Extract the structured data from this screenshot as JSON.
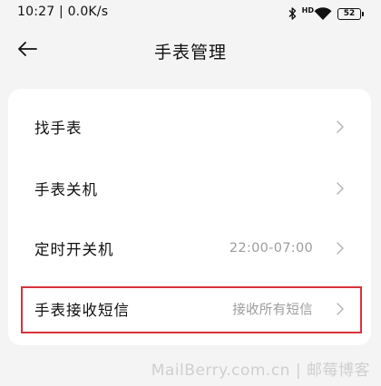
{
  "status_bar": {
    "time_speed": "10:27 | 0.0K/s",
    "hd_label": "HD",
    "battery": "52"
  },
  "header": {
    "title": "手表管理"
  },
  "settings": [
    {
      "label": "找手表",
      "value": ""
    },
    {
      "label": "手表关机",
      "value": ""
    },
    {
      "label": "定时开关机",
      "value": "22:00-07:00"
    },
    {
      "label": "手表接收短信",
      "value": "接收所有短信"
    }
  ],
  "watermark": "MailBerry.com.cn | 邮莓博客",
  "colors": {
    "background": "#f4f4f4",
    "card": "#ffffff",
    "highlight": "#d9323d",
    "secondary_text": "#9c9c9c"
  }
}
